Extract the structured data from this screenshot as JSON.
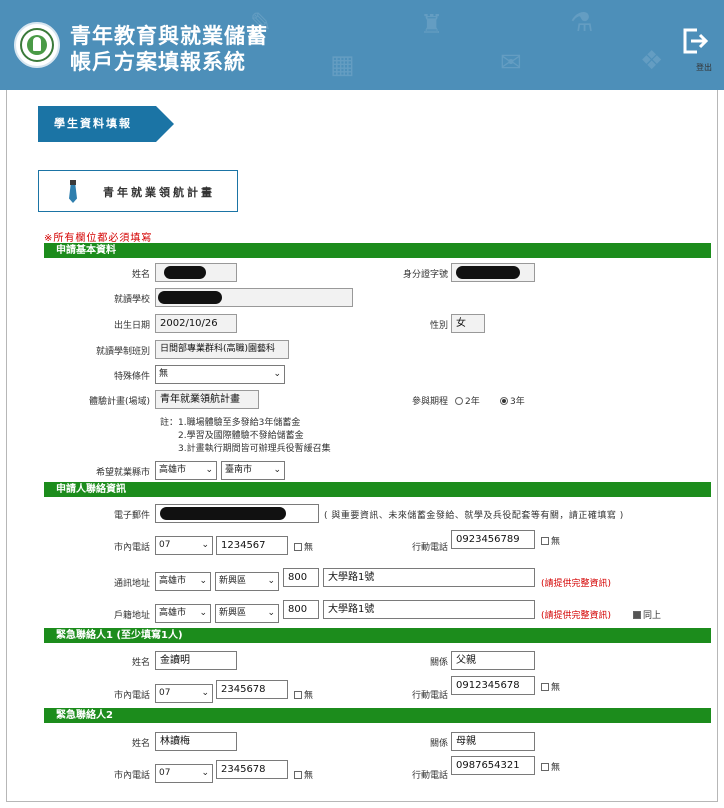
{
  "header": {
    "title_line1": "青年教育與就業儲蓄",
    "title_line2": "帳戶方案填報系統",
    "logout_label": "登出",
    "colors": {
      "header_bg": "#4d8fb9",
      "section_bar": "#1c8c1c",
      "tab_bg": "#1b74a5",
      "required_text": "#d40000"
    }
  },
  "section_tab": "學生資料填報",
  "plan_title": "青年就業領航計畫",
  "required_note": "※所有欄位都必須填寫",
  "basic": {
    "bar_title": "申請基本資料",
    "name_label": "姓名",
    "id_label": "身分證字號",
    "school_label": "就讀學校",
    "birth_label": "出生日期",
    "birth_value": "2002/10/26",
    "gender_label": "性別",
    "gender_value": "女",
    "class_label": "就讀學制班別",
    "class_value": "日間部專業群科(高職)園藝科",
    "special_label": "特殊條件",
    "special_value": "無",
    "plan_label": "體驗計畫(場域)",
    "plan_value": "青年就業領航計畫",
    "period_label": "參與期程",
    "period_options": [
      "2年",
      "3年"
    ],
    "period_selected": "3年",
    "notes": [
      "註：1.職場體驗至多發給3年儲蓄金",
      "2.學習及國際體驗不發給儲蓄金",
      "3.計畫執行期間皆可辦理兵役暫緩召集"
    ],
    "city_label": "希望就業縣市",
    "city_values": [
      "高雄市",
      "臺南市"
    ]
  },
  "contact": {
    "bar_title": "申請人聯絡資訊",
    "email_label": "電子郵件",
    "email_hint": "( 與重要資訊、未來儲蓄金發給、就學及兵役配套等有關，請正確填寫 )",
    "phone_label": "市內電話",
    "phone_area": "07",
    "phone_number": "1234567",
    "none_label": "無",
    "mobile_label": "行動電話",
    "mobile_number": "0923456789",
    "mail_addr_label": "通訊地址",
    "mail_city": "高雄市",
    "mail_district": "新興區",
    "mail_zip": "800",
    "mail_street": "大學路1號",
    "full_addr_hint": "(請提供完整資訊)",
    "home_addr_label": "戶籍地址",
    "home_city": "高雄市",
    "home_district": "新興區",
    "home_zip": "800",
    "home_street": "大學路1號",
    "same_label": "同上"
  },
  "emergency1": {
    "bar_title": "緊急聯絡人1 (至少填寫1人)",
    "name_label": "姓名",
    "name_value": "金讀明",
    "relation_label": "關係",
    "relation_value": "父親",
    "phone_label": "市內電話",
    "phone_area": "07",
    "phone_number": "2345678",
    "none_label": "無",
    "mobile_label": "行動電話",
    "mobile_number": "0912345678"
  },
  "emergency2": {
    "bar_title": "緊急聯絡人2",
    "name_label": "姓名",
    "name_value": "林讀梅",
    "relation_label": "關係",
    "relation_value": "母親",
    "phone_label": "市內電話",
    "phone_area": "07",
    "phone_number": "2345678",
    "none_label": "無",
    "mobile_label": "行動電話",
    "mobile_number": "0987654321"
  }
}
